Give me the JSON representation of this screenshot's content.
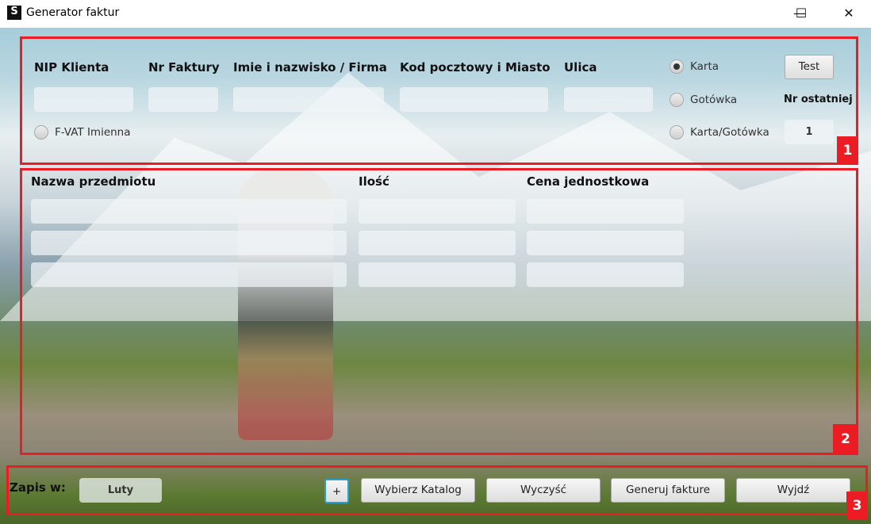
{
  "window": {
    "title": "Generator faktur",
    "logo_text": "S",
    "minimize": "—",
    "maximize": "☐",
    "close": "✕"
  },
  "header": {
    "labels": {
      "nip": "NIP Klienta",
      "nr_faktury": "Nr Faktury",
      "name": "Imie i nazwisko / Firma",
      "postal": "Kod pocztowy i Miasto",
      "street": "Ulica"
    },
    "values": {
      "nip": "",
      "nr_faktury": "",
      "name": "",
      "postal": "",
      "street": ""
    },
    "fvat_label": "F-VAT Imienna",
    "payment": [
      {
        "label": "Karta",
        "selected": true
      },
      {
        "label": "Gotówka",
        "selected": false
      },
      {
        "label": "Karta/Gotówka",
        "selected": false
      }
    ],
    "test_button": "Test",
    "last_number_label": "Nr ostatniej",
    "last_number_value": "1"
  },
  "items": {
    "headers": {
      "name": "Nazwa przedmiotu",
      "qty": "Ilość",
      "price": "Cena jednostkowa"
    },
    "rows": [
      {
        "name": "",
        "qty": "",
        "price": ""
      },
      {
        "name": "",
        "qty": "",
        "price": ""
      },
      {
        "name": "",
        "qty": "",
        "price": ""
      }
    ]
  },
  "footer": {
    "save_label": "Zapis w:",
    "month": "Luty",
    "plus": "+",
    "choose_dir": "Wybierz Katalog",
    "clear": "Wyczyść",
    "generate": "Generuj fakture",
    "exit": "Wyjdź"
  },
  "annotations": [
    "1",
    "2",
    "3"
  ]
}
